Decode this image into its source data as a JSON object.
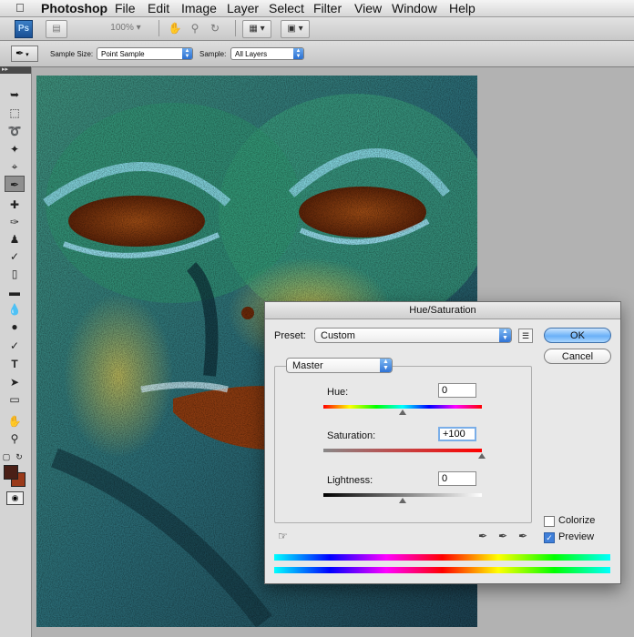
{
  "menubar": {
    "app_name": "Photoshop",
    "items": [
      "File",
      "Edit",
      "Image",
      "Layer",
      "Select",
      "Filter",
      "View",
      "Window",
      "Help"
    ]
  },
  "appbar": {
    "logo": "Ps",
    "zoom": "100%"
  },
  "options": {
    "sample_size_label": "Sample Size:",
    "sample_size_value": "Point Sample",
    "sample_label": "Sample:",
    "sample_value": "All Layers"
  },
  "dialog": {
    "title": "Hue/Saturation",
    "preset_label": "Preset:",
    "preset_value": "Custom",
    "ok_label": "OK",
    "cancel_label": "Cancel",
    "edit_value": "Master",
    "hue_label": "Hue:",
    "hue_value": "0",
    "saturation_label": "Saturation:",
    "saturation_value": "+100",
    "lightness_label": "Lightness:",
    "lightness_value": "0",
    "colorize_label": "Colorize",
    "colorize_checked": false,
    "preview_label": "Preview",
    "preview_checked": true
  },
  "colors": {
    "foreground": "#4a1f16",
    "background": "#9a3a1a"
  }
}
